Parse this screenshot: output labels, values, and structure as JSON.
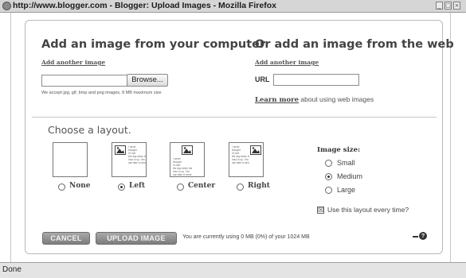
{
  "window": {
    "title": "http://www.blogger.com - Blogger: Upload Images - Mozilla Firefox",
    "controls": {
      "minimize": "_",
      "maximize": "□",
      "close": "×"
    },
    "status": "Done"
  },
  "upload": {
    "computer_heading": "Add an image from your computer",
    "add_another_computer": "Add another image",
    "browse_label": "Browse...",
    "accept_note": "We accept jpg, gif, bmp and png images, 8 MB maximum size",
    "web_heading": "Or add an image from the web",
    "add_another_web": "Add another image",
    "url_label": "URL",
    "url_value": "",
    "learn_more_link": "Learn more",
    "learn_more_rest": " about using web images"
  },
  "layout": {
    "heading": "Choose a layout.",
    "thumb_text": "I never\nthought\nI'd see\nthe day when the\nhour is up. You\ncan take a horse",
    "options": [
      {
        "label": "None",
        "selected": false
      },
      {
        "label": "Left",
        "selected": true
      },
      {
        "label": "Center",
        "selected": false
      },
      {
        "label": "Right",
        "selected": false
      }
    ]
  },
  "image_size": {
    "heading": "Image size:",
    "options": [
      {
        "label": "Small",
        "selected": false
      },
      {
        "label": "Medium",
        "selected": true
      },
      {
        "label": "Large",
        "selected": false
      }
    ]
  },
  "remember": {
    "label": "Use this layout every time?",
    "checked": true,
    "check_glyph": "☒"
  },
  "footer": {
    "cancel_label": "CANCEL",
    "upload_label": "UPLOAD IMAGE",
    "quota_text": "You are currently using 0 MB (0%) of your 1024 MB",
    "help_glyph": "?"
  },
  "colors": {
    "button_gradient_top": "#a9a9a9",
    "button_gradient_bottom": "#7d7d7d",
    "dialog_border": "#b9b9b9"
  }
}
